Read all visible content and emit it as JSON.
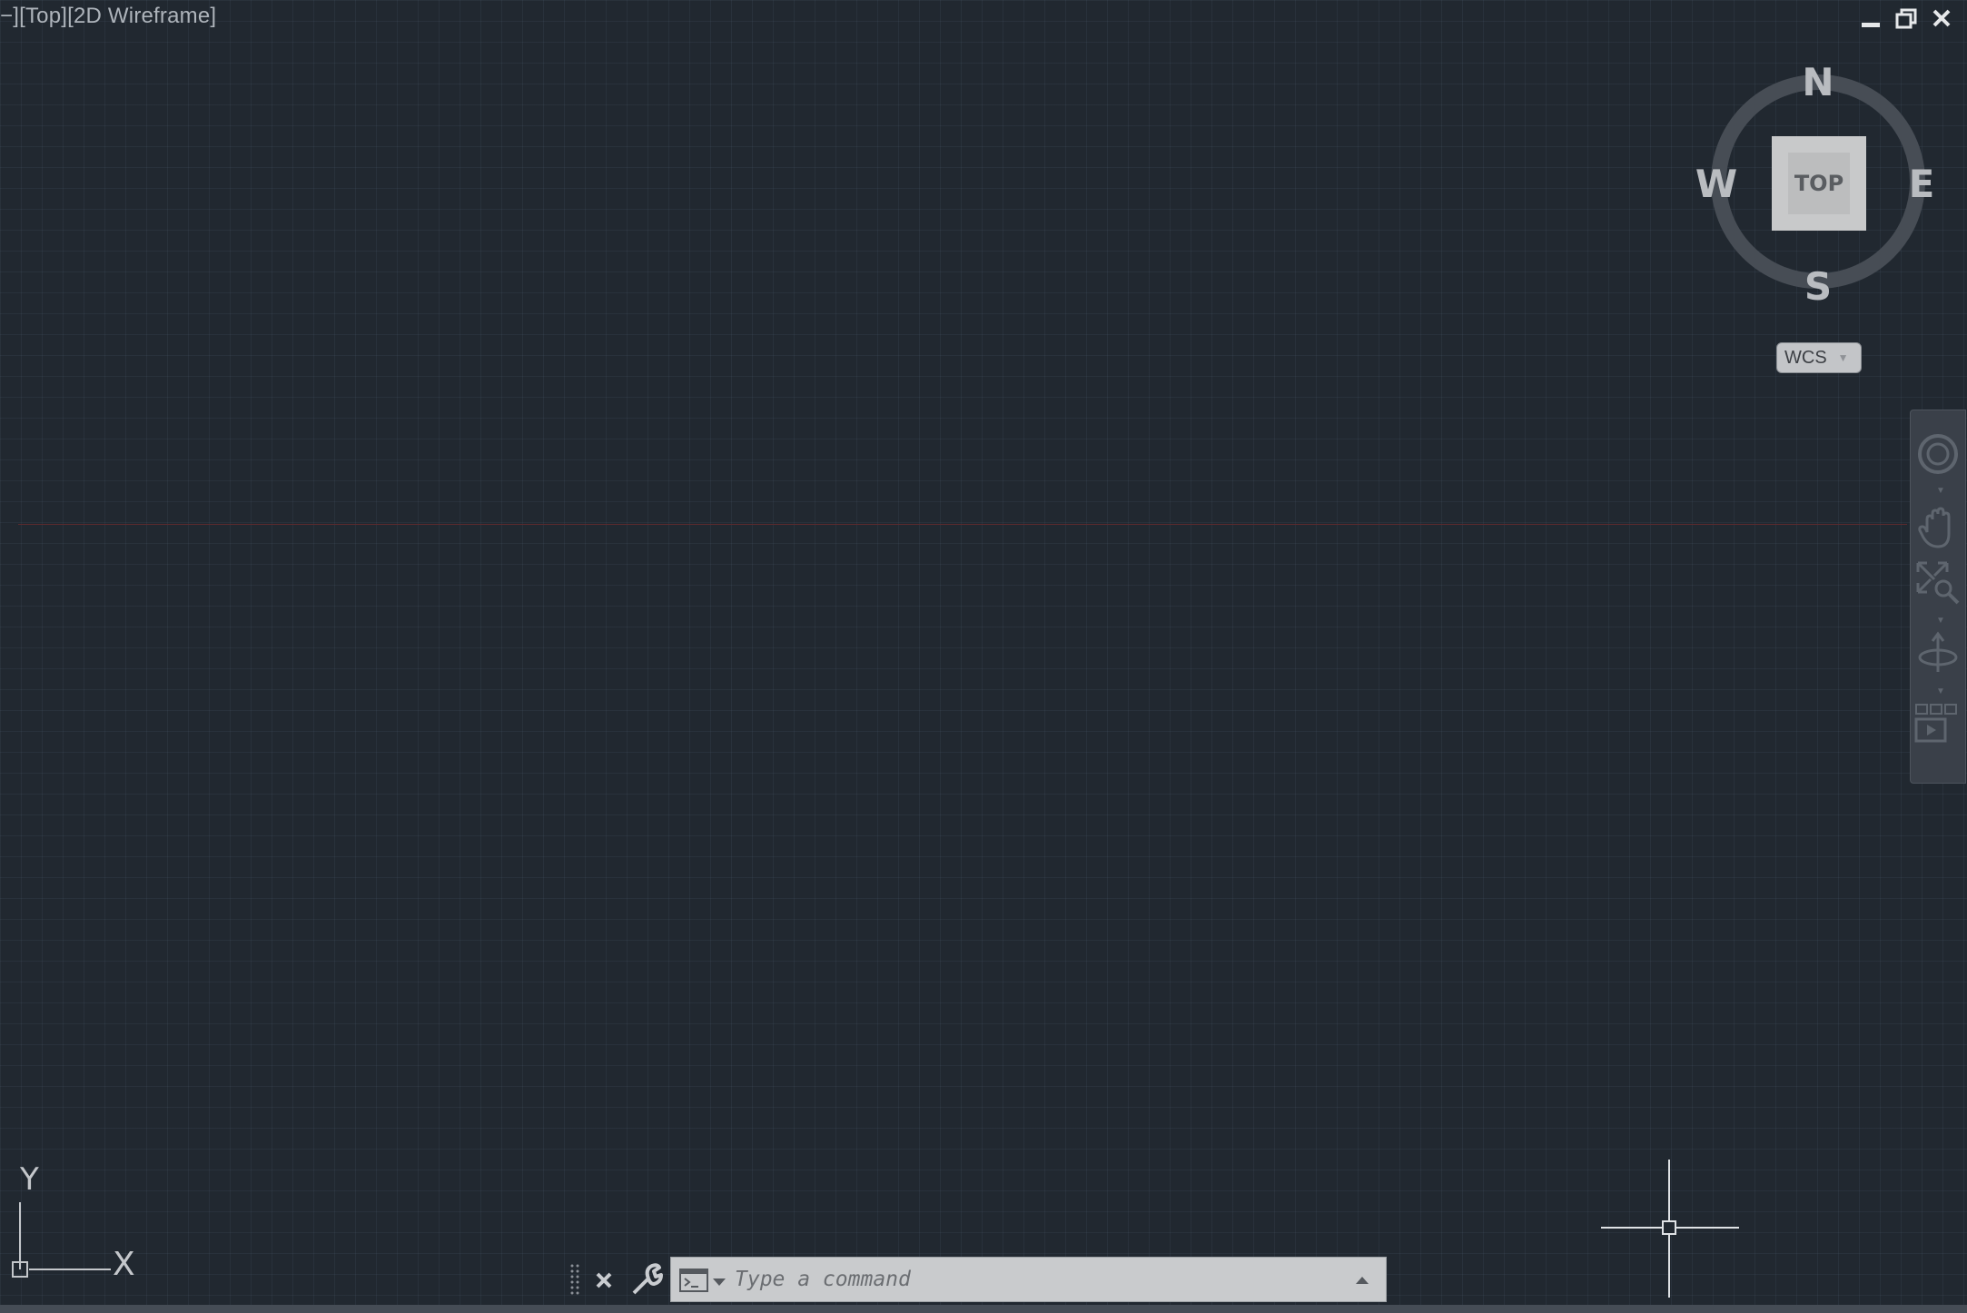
{
  "viewport": {
    "label": "−][Top][2D Wireframe]"
  },
  "window_controls": {
    "minimize_icon": "minimize-icon",
    "restore_icon": "restore-icon",
    "close_icon": "close-icon"
  },
  "viewcube": {
    "north": "N",
    "south": "S",
    "east": "E",
    "west": "W",
    "face": "TOP",
    "ucs_menu_label": "WCS"
  },
  "navigation_bar": {
    "tools": [
      "steering-wheel-icon",
      "pan-hand-icon",
      "zoom-extents-icon",
      "orbit-icon",
      "showmotion-icon"
    ]
  },
  "ucs_icon": {
    "x_label": "X",
    "y_label": "Y"
  },
  "command_line": {
    "placeholder": "Type a command",
    "value": ""
  },
  "colors": {
    "canvas": "#212830",
    "x_axis": "#5a2a2e",
    "viewcube_face": "#c8c9ca",
    "command_bar": "#c9cbcd"
  }
}
